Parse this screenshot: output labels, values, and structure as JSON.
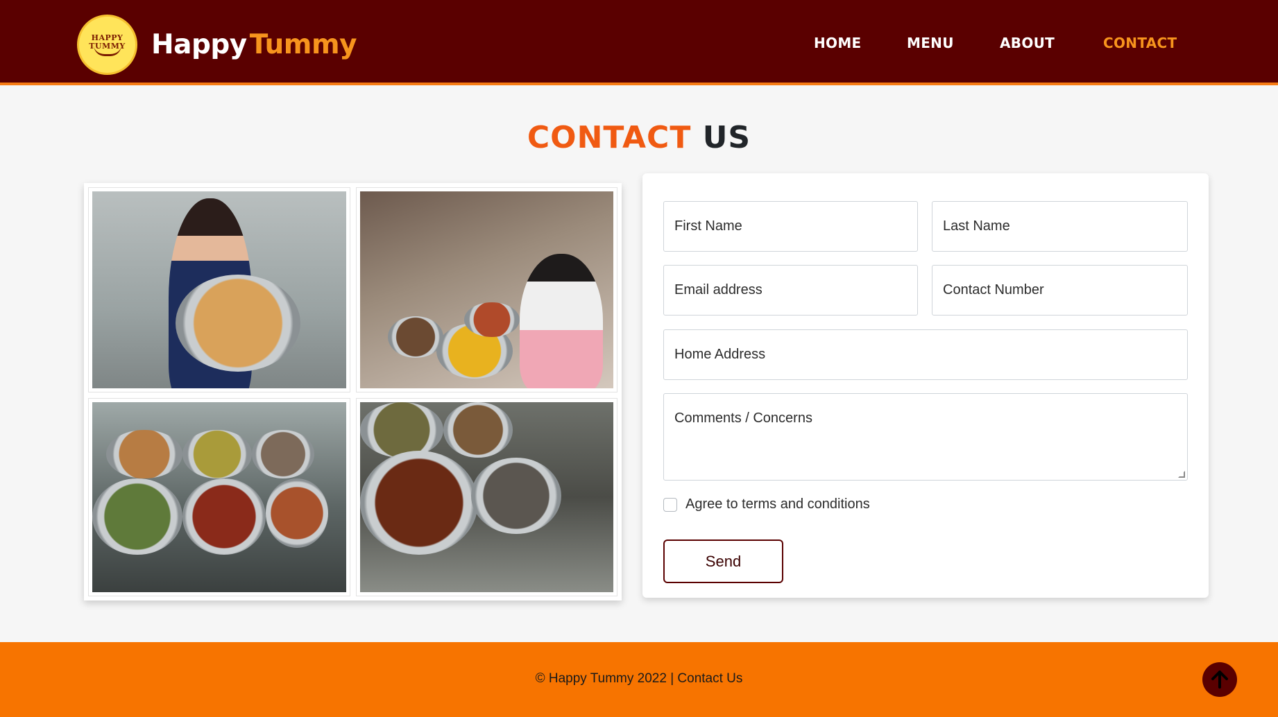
{
  "navbar": {
    "logo_line1": "HAPPY",
    "logo_line2": "TUMMY",
    "brand_first": "Happy",
    "brand_second": "Tummy",
    "links": [
      {
        "label": "HOME",
        "active": false
      },
      {
        "label": "MENU",
        "active": false
      },
      {
        "label": "ABOUT",
        "active": false
      },
      {
        "label": "CONTACT",
        "active": true
      }
    ]
  },
  "page": {
    "title_accent": "CONTACT",
    "title_rest": "US"
  },
  "form": {
    "first_name_placeholder": "First Name",
    "last_name_placeholder": "Last Name",
    "email_placeholder": "Email address",
    "phone_placeholder": "Contact Number",
    "address_placeholder": "Home Address",
    "comments_placeholder": "Comments / Concerns",
    "terms_label": "Agree to terms and conditions",
    "terms_checked": false,
    "send_label": "Send"
  },
  "footer": {
    "text": "© Happy Tummy 2022 | Contact Us",
    "top_button_icon": "arrow-up-icon"
  },
  "colors": {
    "nav_bg": "#5a0000",
    "accent_orange": "#f7941d",
    "title_orange": "#f05a12",
    "footer_bg": "#f77400"
  }
}
